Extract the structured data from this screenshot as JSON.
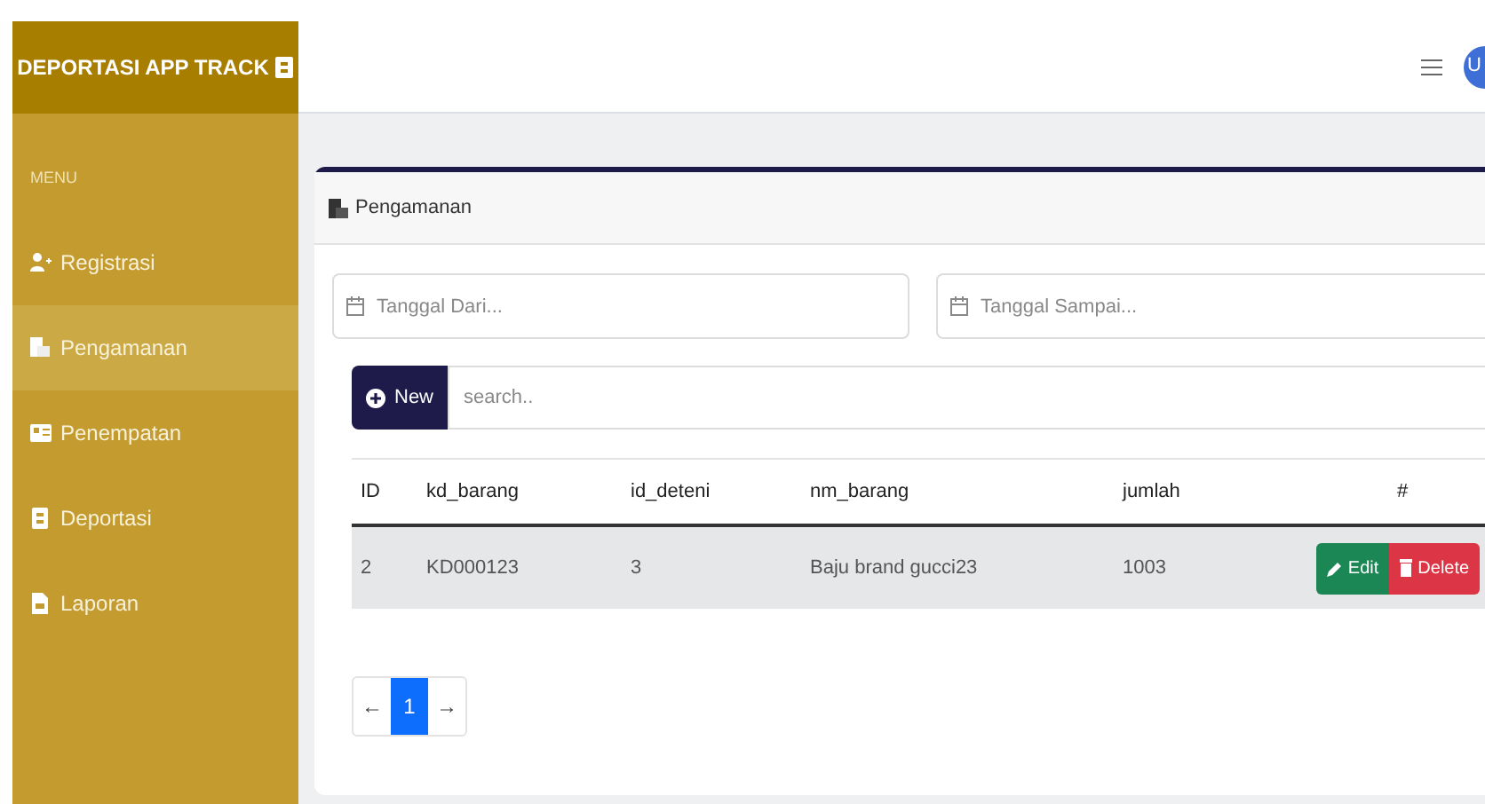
{
  "brand": {
    "title": "DEPORTASI APP TRACK"
  },
  "sidebar": {
    "heading": "MENU",
    "items": [
      {
        "label": "Registrasi",
        "selected": false
      },
      {
        "label": "Pengamanan",
        "selected": true
      },
      {
        "label": "Penempatan",
        "selected": false
      },
      {
        "label": "Deportasi",
        "selected": false
      },
      {
        "label": "Laporan",
        "selected": false
      }
    ]
  },
  "topbar": {
    "avatar": "U"
  },
  "card": {
    "title": "Pengamanan",
    "date_from": {
      "placeholder": "Tanggal Dari..."
    },
    "date_to": {
      "placeholder": "Tanggal Sampai..."
    },
    "new_button": "New",
    "search": {
      "placeholder": "search.."
    },
    "table": {
      "columns": [
        "ID",
        "kd_barang",
        "id_deteni",
        "nm_barang",
        "jumlah",
        "#"
      ],
      "rows": [
        {
          "cells": [
            "2",
            "KD000123",
            "3",
            "Baju brand gucci23",
            "1003"
          ],
          "actions": [
            "Edit",
            "Delete"
          ]
        }
      ]
    },
    "pagination": {
      "prev": "←",
      "next": "→",
      "pages": [
        {
          "label": "1",
          "selected": true
        }
      ]
    }
  }
}
